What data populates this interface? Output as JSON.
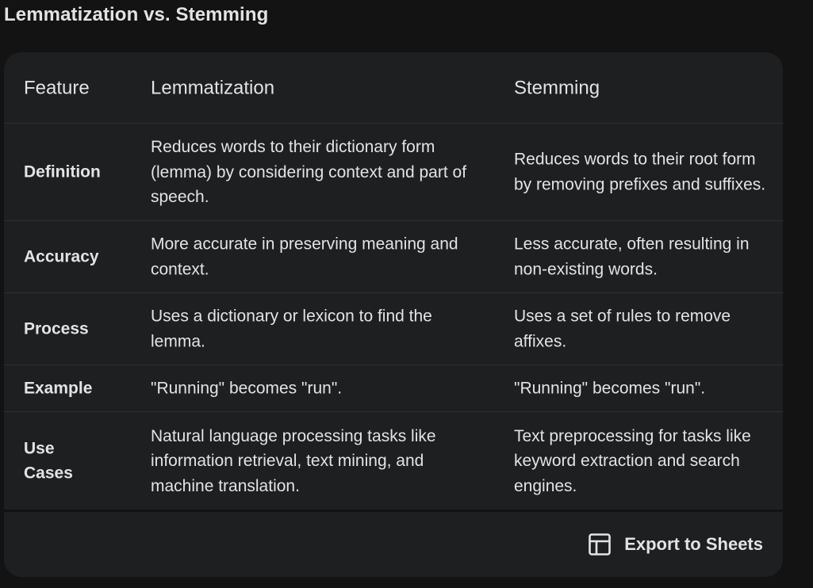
{
  "title": "Lemmatization vs. Stemming",
  "table": {
    "headers": [
      "Feature",
      "Lemmatization",
      "Stemming"
    ],
    "rows": [
      {
        "feature": "Definition",
        "lemmatization": "Reduces words to their dictionary form (lemma) by considering context and part of speech.",
        "stemming": "Reduces words to their root form by removing prefixes and suffixes."
      },
      {
        "feature": "Accuracy",
        "lemmatization": "More accurate in preserving meaning and context.",
        "stemming": "Less accurate, often resulting in non-existing words."
      },
      {
        "feature": "Process",
        "lemmatization": "Uses a dictionary or lexicon to find the lemma.",
        "stemming": "Uses a set of rules to remove affixes."
      },
      {
        "feature": "Example",
        "lemmatization": "\"Running\" becomes \"run\".",
        "stemming": "\"Running\" becomes \"run\"."
      },
      {
        "feature": "Use Cases",
        "lemmatization": "Natural language processing tasks like information retrieval, text mining, and machine translation.",
        "stemming": "Text preprocessing for tasks like keyword extraction and search engines."
      }
    ]
  },
  "footer": {
    "export_label": "Export to Sheets",
    "export_icon": "table-grid-icon"
  }
}
